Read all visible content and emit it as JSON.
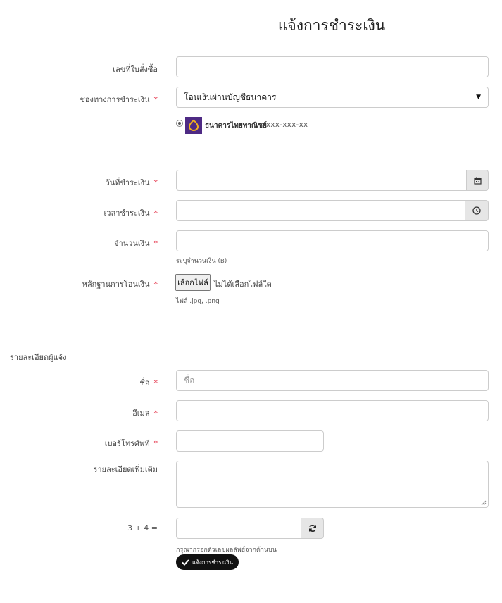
{
  "page": {
    "title": "แจ้งการชำระเงิน"
  },
  "form": {
    "order_no": {
      "label": "เลขที่ใบสั่งซื้อ",
      "value": ""
    },
    "payment_method": {
      "label": "ช่องทางการชำระเงิน",
      "required_mark": "*",
      "selected": "โอนเงินผ่านบัญชีธนาคาร",
      "bank_option": {
        "name": "ธนาคารไทยพาณิชย์",
        "account": "xxx-xxx-xx"
      }
    },
    "pay_date": {
      "label": "วันที่ชำระเงิน",
      "required_mark": "*",
      "value": ""
    },
    "pay_time": {
      "label": "เวลาชำระเงิน",
      "required_mark": "*",
      "value": ""
    },
    "amount": {
      "label": "จำนวนเงิน",
      "required_mark": "*",
      "value": "",
      "help": "ระบุจำนวนเงิน (฿)"
    },
    "proof": {
      "label": "หลักฐานการโอนเงิน",
      "required_mark": "*",
      "button": "เลือกไฟล์",
      "status": "ไม่ได้เลือกไฟล์ใด",
      "help": "ไฟล์ .jpg, .png"
    }
  },
  "contact": {
    "section_title": "รายละเอียดผู้แจ้ง",
    "name": {
      "label": "ชื่อ",
      "required_mark": "*",
      "placeholder": "ชื่อ"
    },
    "email": {
      "label": "อีเมล",
      "required_mark": "*",
      "value": ""
    },
    "phone": {
      "label": "เบอร์โทรศัพท์",
      "required_mark": "*",
      "value": ""
    },
    "details": {
      "label": "รายละเอียดเพิ่มเติม",
      "value": ""
    },
    "captcha": {
      "question": "3 + 4 =",
      "help": "กรุณากรอกตัวเลขผลลัพธ์จากด้านบน"
    },
    "submit": "แจ้งการชำระเงิน"
  },
  "icons": [
    "calendar-icon",
    "clock-icon",
    "refresh-icon",
    "check-icon",
    "scb-logo-icon",
    "dropdown-arrow-icon"
  ]
}
